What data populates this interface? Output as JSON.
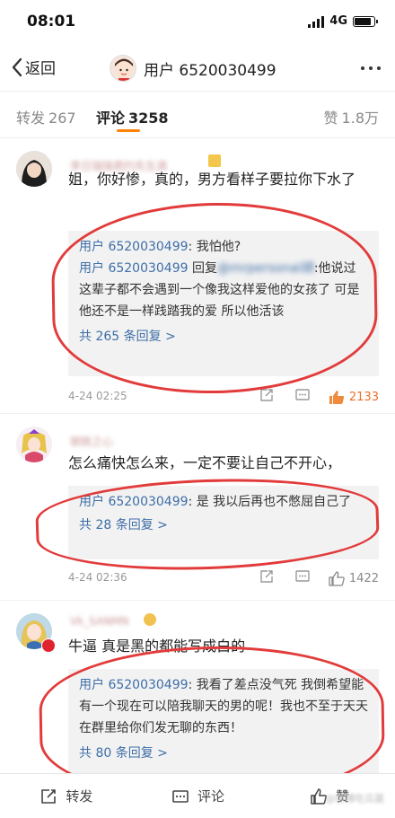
{
  "status": {
    "time": "08:01",
    "network": "4G"
  },
  "nav": {
    "back_label": "返回",
    "title": "用户 6520030499"
  },
  "tabs": {
    "repost_label": "转发",
    "repost_count": "267",
    "comment_label": "评论",
    "comment_count": "3258",
    "like_label": "赞",
    "like_count": "1.8万"
  },
  "comments": [
    {
      "username": "李日瑞瑞君约先生酒",
      "text": "姐，你好惨，真的，男方看样子要拉你下水了",
      "replies": [
        {
          "user": "用户 6520030499",
          "text": ": 我怕他?"
        },
        {
          "user": "用户 6520030499",
          "reply_word": " 回复",
          "target": "@mrpersonal胡",
          "text": ":他说过 这辈子都不会遇到一个像我这样爱他的女孩了 可是他还不是一样践踏我的爱 所以他活该"
        }
      ],
      "more_replies": "共 265 条回复 >",
      "date": "4-24 02:25",
      "likes": "2133"
    },
    {
      "username": "钢铁之心",
      "text": "怎么痛快怎么来，一定不要让自己不开心，",
      "replies": [
        {
          "user": "用户 6520030499",
          "text": ": 是 我以后再也不憋屈自己了"
        }
      ],
      "more_replies": "共 28 条回复 >",
      "date": "4-24 02:36",
      "likes": "1422"
    },
    {
      "username": "Vk_SANMN",
      "text": "牛逼 真是黑的都能写成白的",
      "replies": [
        {
          "user": "用户 6520030499",
          "text": ": 我看了差点没气死 我倒希望能有一个现在可以陪我聊天的男的呢！我也不至于天天在群里给你们发无聊的东西！"
        }
      ],
      "more_replies": "共 80 条回复 >"
    }
  ],
  "bottom": {
    "repost": "转发",
    "comment": "评论",
    "like": "赞"
  },
  "watermark": "@微博吃瓜菌",
  "colors": {
    "accent": "#ff8200",
    "link": "#3d6ea8",
    "circle": "#e23b3b"
  }
}
